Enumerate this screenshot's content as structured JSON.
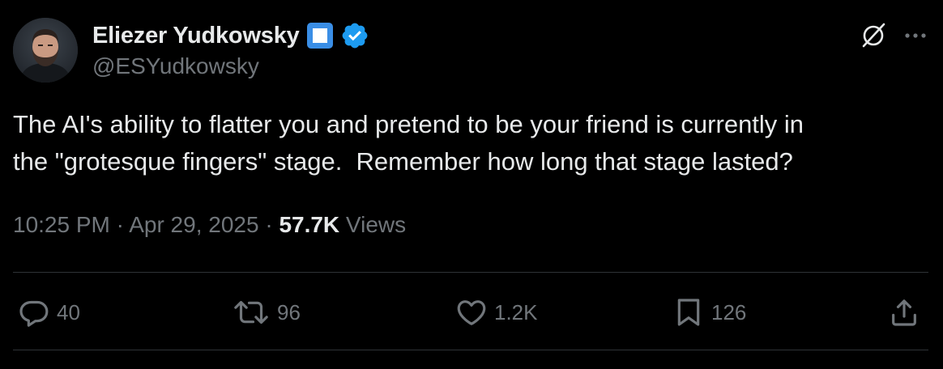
{
  "author": {
    "display_name": "Eliezer Yudkowsky",
    "handle": "@ESYudkowsky"
  },
  "tweet": {
    "text": "The AI's ability to flatter you and pretend to be your friend is currently in\nthe \"grotesque fingers\" stage.  Remember how long that stage lasted?",
    "time": "10:25 PM",
    "separator": " · ",
    "date": "Apr 29, 2025",
    "views_count": "57.7K",
    "views_label": " Views"
  },
  "actions": {
    "replies": "40",
    "retweets": "96",
    "likes": "1.2K",
    "bookmarks": "126"
  },
  "icons": {
    "header": [
      "grok-icon",
      "more-icon"
    ],
    "badges": [
      "square-badge-icon",
      "verified-badge-icon"
    ],
    "actions": [
      "reply-icon",
      "retweet-icon",
      "like-icon",
      "bookmark-icon",
      "share-icon"
    ]
  },
  "colors": {
    "background": "#000000",
    "text_primary": "#e7e9ea",
    "text_secondary": "#71767b",
    "divider": "#2f3336",
    "verified_blue": "#1d9bf0",
    "square_badge_blue": "#3a8ee6"
  }
}
